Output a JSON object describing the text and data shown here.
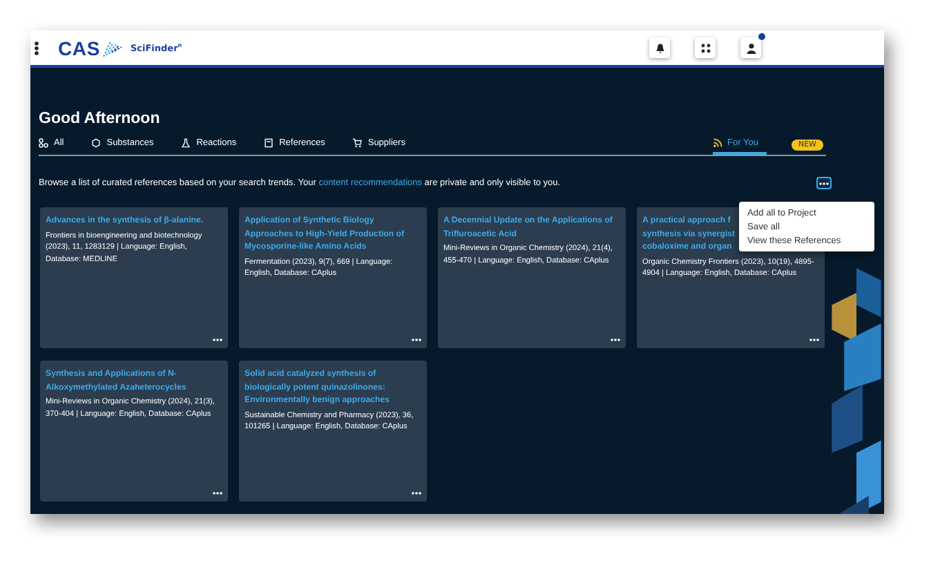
{
  "header": {
    "logo": "CAS",
    "product": "SciFinder$^{n}$",
    "notification_dot": true
  },
  "greeting": "Good Afternoon",
  "tabs": [
    {
      "label": "All",
      "kind": "all",
      "selected": false
    },
    {
      "label": "Substances",
      "kind": "substances",
      "selected": false
    },
    {
      "label": "Reactions",
      "kind": "reactions",
      "selected": false
    },
    {
      "label": "References",
      "kind": "references",
      "selected": false
    },
    {
      "label": "Suppliers",
      "kind": "suppliers",
      "selected": false
    },
    {
      "label": "For You",
      "kind": "foryou",
      "selected": true,
      "badge": "NEW"
    }
  ],
  "intro": {
    "before": "Browse a list of curated references based on your search trends. Your",
    "link": "content recommendations",
    "after": "are private and only visible to you."
  },
  "menu": {
    "items": [
      "Add all to Project",
      "Save all",
      "View these References"
    ]
  },
  "cards": [
    {
      "title": "Advances in the synthesis of β-alanine.",
      "meta": "Frontiers in bioengineering and biotechnology (2023), 11, 1283129 | Language: English, Database: MEDLINE"
    },
    {
      "title": "Application of Synthetic Biology Approaches to High-Yield Production of Mycosporine-like Amino Acids",
      "meta": "Fermentation (2023), 9(7), 669 | Language: English, Database: CAplus"
    },
    {
      "title": "A Decennial Update on the Applications of Trifluroacetic Acid",
      "meta": "Mini-Reviews in Organic Chemistry (2024), 21(4), 455-470 | Language: English, Database: CAplus"
    },
    {
      "title": "A practical approach f\nsynthesis via synergist\ncobaloxime and organ",
      "meta": "Organic Chemistry Frontiers (2023), 10(19), 4895-4904 | Language: English, Database: CAplus"
    },
    {
      "title": "Synthesis and Applications of N-Alkoxymethylated Azaheterocycles",
      "meta": "Mini-Reviews in Organic Chemistry (2024), 21(3), 370-404 | Language: English, Database: CAplus"
    },
    {
      "title": "Solid acid catalyzed synthesis of biologically potent quinazolinones: Environmentally benign approaches",
      "meta": "Sustainable Chemistry and Pharmacy (2023), 36, 101265 | Language: English, Database: CAplus"
    }
  ]
}
